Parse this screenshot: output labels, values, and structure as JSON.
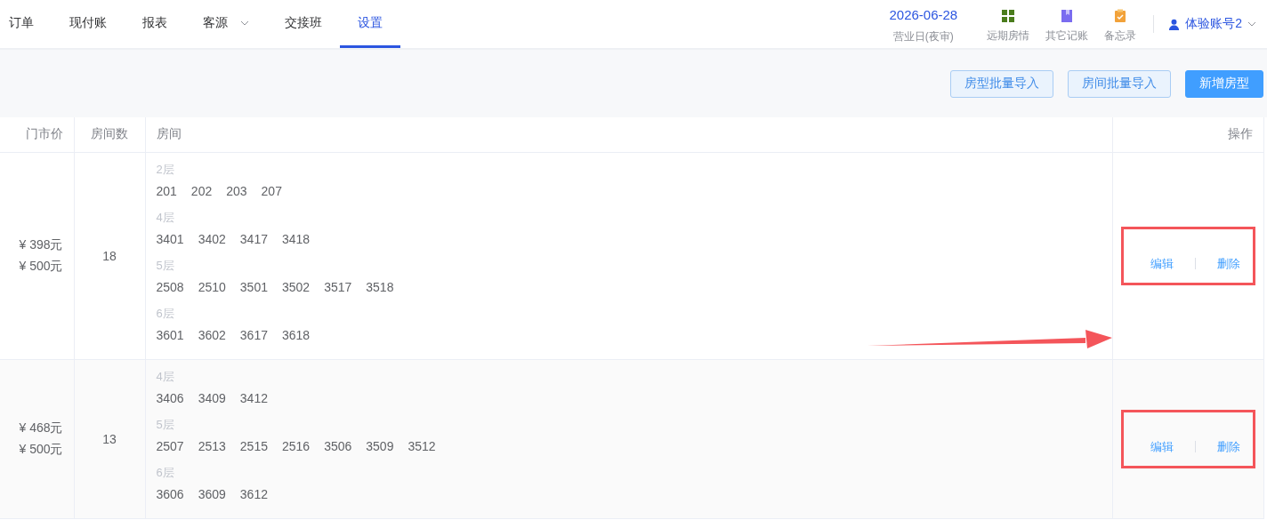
{
  "nav": {
    "tabs": [
      {
        "label": "订单",
        "selected": false,
        "has_menu": false
      },
      {
        "label": "现付账",
        "selected": false,
        "has_menu": false
      },
      {
        "label": "报表",
        "selected": false,
        "has_menu": false
      },
      {
        "label": "客源",
        "selected": false,
        "has_menu": true
      },
      {
        "label": "交接班",
        "selected": false,
        "has_menu": false
      },
      {
        "label": "设置",
        "selected": true,
        "has_menu": false
      }
    ],
    "business_date": {
      "date": "2026-06-28",
      "label": "营业日(夜审)"
    },
    "shortcuts": [
      {
        "kind": "grid",
        "label": "远期房情"
      },
      {
        "kind": "book",
        "label": "其它记账"
      },
      {
        "kind": "clipboard",
        "label": "备忘录"
      }
    ],
    "account": "体验账号2"
  },
  "toolbar": {
    "buttons": [
      {
        "label": "房型批量导入",
        "kind": "secondary"
      },
      {
        "label": "房间批量导入",
        "kind": "secondary"
      },
      {
        "label": "新增房型",
        "kind": "primary"
      }
    ]
  },
  "table": {
    "columns": [
      "门市价",
      "房间数",
      "房间",
      "操作"
    ],
    "rows": [
      {
        "prices": [
          "¥ 398元",
          "¥ 500元"
        ],
        "room_count": "18",
        "floors": [
          {
            "label": "2层",
            "rooms": [
              "201",
              "202",
              "203",
              "207"
            ]
          },
          {
            "label": "4层",
            "rooms": [
              "3401",
              "3402",
              "3417",
              "3418"
            ]
          },
          {
            "label": "5层",
            "rooms": [
              "2508",
              "2510",
              "3501",
              "3502",
              "3517",
              "3518"
            ]
          },
          {
            "label": "6层",
            "rooms": [
              "3601",
              "3602",
              "3617",
              "3618"
            ]
          }
        ],
        "actions": [
          "编辑",
          "删除"
        ],
        "highlighted": true
      },
      {
        "prices": [
          "¥ 468元",
          "¥ 500元"
        ],
        "room_count": "13",
        "floors": [
          {
            "label": "4层",
            "rooms": [
              "3406",
              "3409",
              "3412"
            ]
          },
          {
            "label": "5层",
            "rooms": [
              "2507",
              "2513",
              "2515",
              "2516",
              "3506",
              "3509",
              "3512"
            ]
          },
          {
            "label": "6层",
            "rooms": [
              "3606",
              "3609",
              "3612"
            ]
          }
        ],
        "actions": [
          "编辑",
          "删除"
        ],
        "highlighted": true
      }
    ]
  },
  "annotations": [
    {
      "kind": "arrow"
    }
  ]
}
